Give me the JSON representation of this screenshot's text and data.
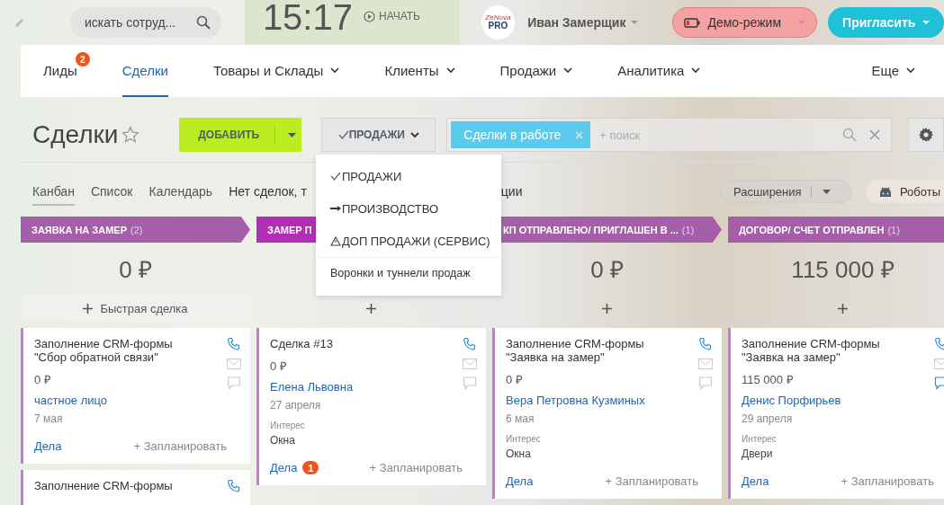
{
  "topbar": {
    "search_placeholder": "искать сотруд...",
    "time": "15:17",
    "start_label": "НАЧАТЬ",
    "logo_line1": "ZeNova",
    "logo_line2": "PRO",
    "user_name": "Иван Замерщик",
    "demo_label": "Демо-режим",
    "invite_label": "Пригласить"
  },
  "nav": [
    {
      "label": "Лиды",
      "badge": "2",
      "selected": false,
      "dropdown": false
    },
    {
      "label": "Сделки",
      "selected": true,
      "dropdown": false
    },
    {
      "label": "Товары и Склады",
      "selected": false,
      "dropdown": true
    },
    {
      "label": "Клиенты",
      "selected": false,
      "dropdown": true
    },
    {
      "label": "Продажи",
      "selected": false,
      "dropdown": true
    },
    {
      "label": "Аналитика",
      "selected": false,
      "dropdown": true
    },
    {
      "label": "Еще",
      "selected": false,
      "dropdown": true
    }
  ],
  "page": {
    "title": "Сделки",
    "add_label": "ДОБАВИТЬ",
    "category_label": "ПРОДАЖИ"
  },
  "filter": {
    "tag": "Сделки в работе",
    "placeholder": "+ поиск"
  },
  "views": [
    {
      "label": "Канбан",
      "selected": true
    },
    {
      "label": "Список",
      "selected": false
    },
    {
      "label": "Календарь",
      "selected": false
    }
  ],
  "notice": {
    "start": "Нет сделок, т",
    "end": "ции"
  },
  "extensions_label": "Расширения",
  "robots_label": "Роботы",
  "category_menu": {
    "items": [
      {
        "kind": "check",
        "label": "ПРОДАЖИ"
      },
      {
        "kind": "arrow",
        "label": "ПРОИЗВОДСТВО"
      },
      {
        "kind": "warning",
        "label": "ДОП ПРОДАЖИ (СЕРВИС)"
      }
    ],
    "footer": "Воронки и туннели продаж"
  },
  "columns": [
    {
      "title": "ЗАЯВКА НА ЗАМЕР",
      "count": "(2)",
      "color": "#a55fa9",
      "sum": "0 ₽",
      "quick_add": "Быстрая сделка",
      "cards": [
        {
          "title": "Заполнение CRM-формы \"Сбор обратной связи\"",
          "amount": "0 ₽",
          "contact": "частное лицо",
          "date": "7 мая",
          "activities_label": "Дела",
          "plan_label": "+ Запланировать",
          "chat_active": false
        },
        {
          "title": "Заполнение CRM-формы"
        }
      ]
    },
    {
      "title": "ЗАМЕР П",
      "color": "#b22fb4",
      "cards": [
        {
          "title": "Сделка #13",
          "amount": "0 ₽",
          "contact": "Елена Львовна",
          "date": "27 апреля",
          "interest_label": "Интерес",
          "interest": "Окна",
          "activities_label": "Дела",
          "activities_badge": "1",
          "plan_label": "+ Запланировать",
          "chat_active": false
        }
      ]
    },
    {
      "title": "КП ОТПРАВЛЕНО/ ПРИГЛАШЕН В ...",
      "count": "(1)",
      "color": "#a55fa9",
      "sum": "0 ₽",
      "cards": [
        {
          "title": "Заполнение CRM-формы \"Заявка на замер\"",
          "amount": "0 ₽",
          "contact": "Вера Петровна Кузминых",
          "date": "6 мая",
          "interest_label": "Интерес",
          "interest": "Окна",
          "activities_label": "Дела",
          "plan_label": "+ Запланировать",
          "chat_active": false
        }
      ]
    },
    {
      "title": "ДОГОВОР/ СЧЕТ ОТПРАВЛЕН",
      "count": "(1)",
      "color": "#a55fa9",
      "sum": "115 000 ₽",
      "cards": [
        {
          "title": "Заполнение CRM-формы \"Заявка на замер\"",
          "amount": "115 000 ₽",
          "contact": "Денис Порфирьев",
          "date": "29 апреля",
          "interest_label": "Интерес",
          "interest": "Двери",
          "activities_label": "Дела",
          "plan_label": "+ Запланировать",
          "chat_active": true
        }
      ]
    }
  ]
}
